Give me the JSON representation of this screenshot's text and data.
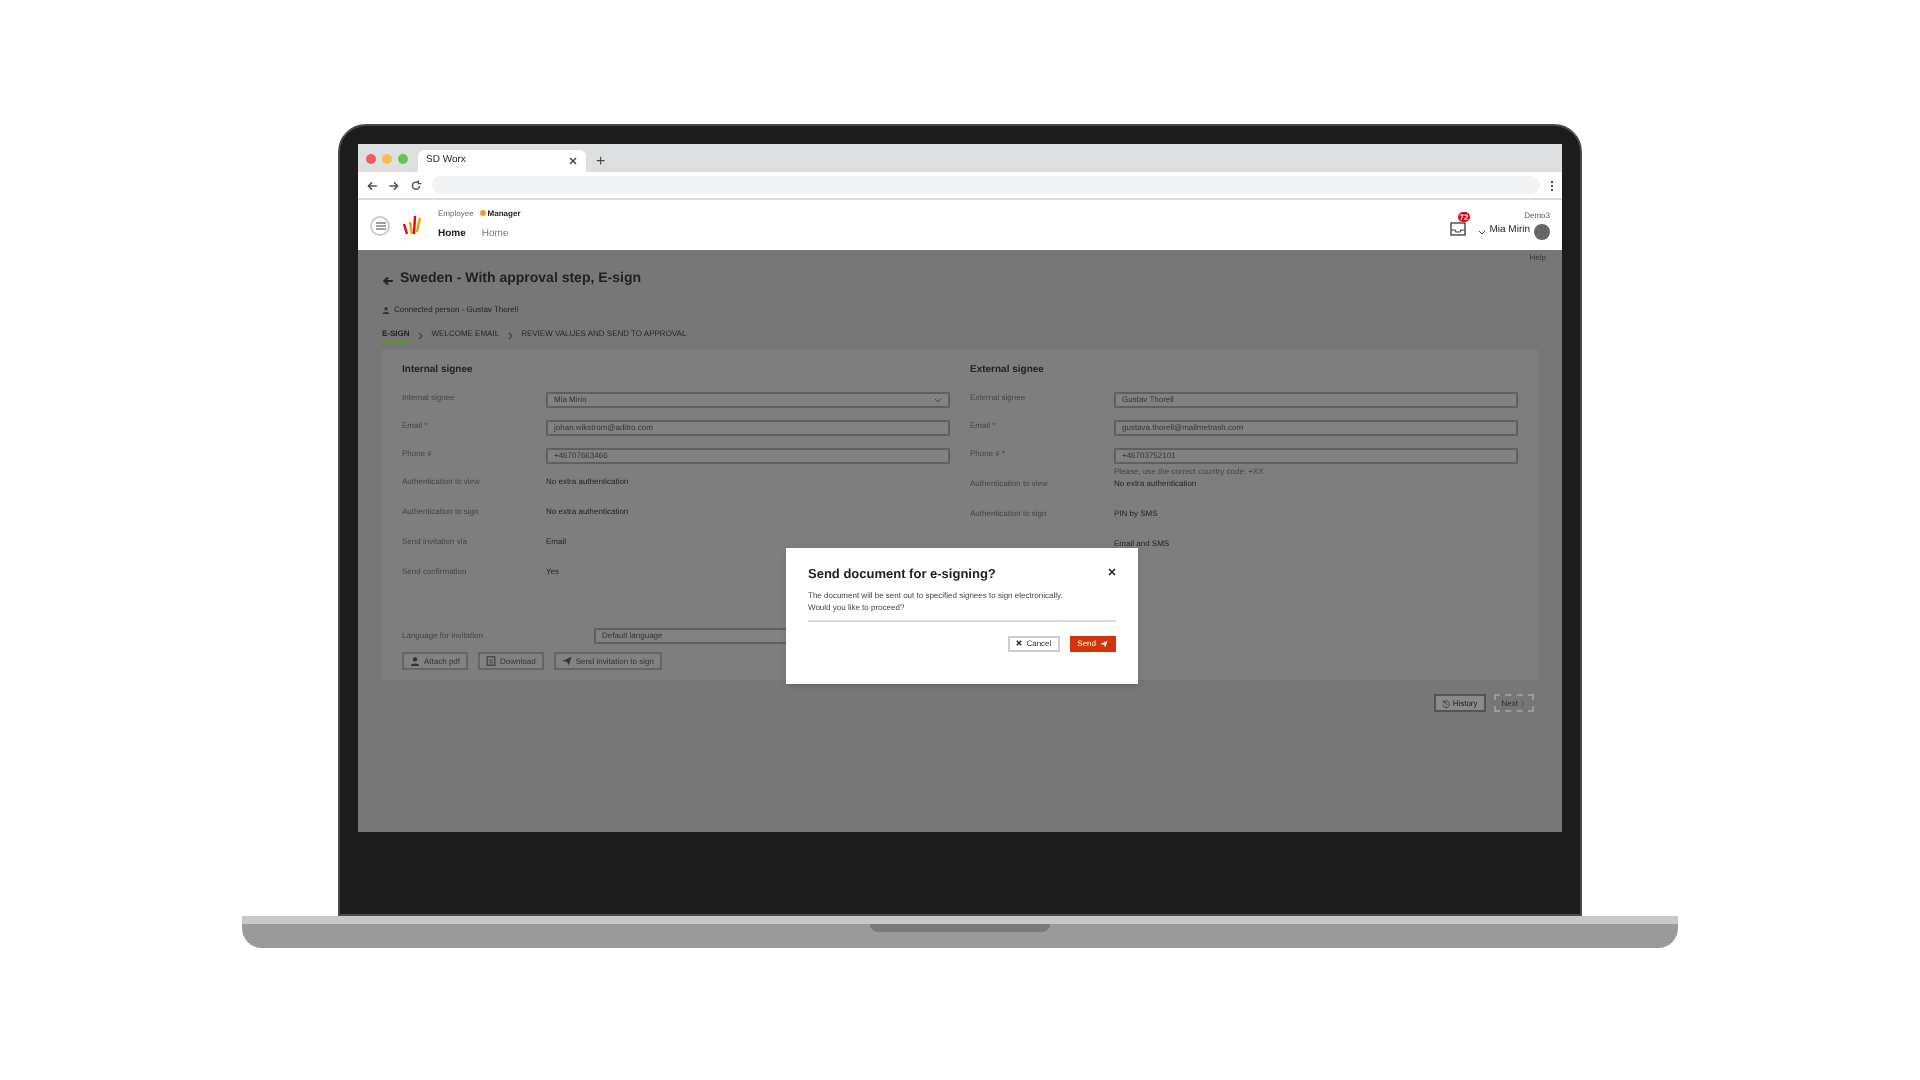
{
  "browser": {
    "tab_title": "SD Worx",
    "new_tab": "+"
  },
  "header": {
    "roles": [
      {
        "label": "Employee",
        "selected": false
      },
      {
        "label": "Manager",
        "selected": true
      }
    ],
    "nav": [
      {
        "label": "Home",
        "selected": true
      },
      {
        "label": "Home",
        "selected": false
      }
    ],
    "company": "Demo3",
    "user": "Mia Mirin",
    "notification_count": "72",
    "help": "Help"
  },
  "page": {
    "title": "Sweden - With approval step, E-sign",
    "connected_person": "Connected person - Gustav Thorell",
    "steps": [
      {
        "label": "E-SIGN",
        "selected": true
      },
      {
        "label": "WELCOME EMAIL",
        "selected": false
      },
      {
        "label": "REVIEW VALUES AND SEND TO APPROVAL",
        "selected": false
      }
    ]
  },
  "internal": {
    "heading": "Internal signee",
    "fields": [
      {
        "kind": "select",
        "label": "Internal signee",
        "value": "Mia Mirin"
      },
      {
        "kind": "input",
        "label": "Email *",
        "value": "johan.wikstrom@aditro.com"
      },
      {
        "kind": "input",
        "label": "Phone #",
        "value": "+46707663466"
      },
      {
        "kind": "text",
        "label": "Authentication to view",
        "value": "No extra authentication"
      },
      {
        "kind": "text",
        "label": "Authentication to sign",
        "value": "No extra authentication"
      },
      {
        "kind": "text",
        "label": "Send invitation via",
        "value": "Email"
      },
      {
        "kind": "text",
        "label": "Send confirmation",
        "value": "Yes"
      }
    ]
  },
  "external": {
    "heading": "External signee",
    "fields": [
      {
        "kind": "input",
        "label": "External signee",
        "value": "Gustav Thorell"
      },
      {
        "kind": "input",
        "label": "Email *",
        "value": "gustava.thorell@mailmetrash.com"
      },
      {
        "kind": "input",
        "label": "Phone # *",
        "value": "+46703752101",
        "hint": "Please, use the correct country code: +XX"
      },
      {
        "kind": "text",
        "label": "Authentication to view",
        "value": "No extra authentication"
      },
      {
        "kind": "text",
        "label": "Authentication to sign",
        "value": "PIN by SMS"
      },
      {
        "kind": "text",
        "value": "Email and SMS"
      }
    ]
  },
  "language": {
    "label": "Language for invitation",
    "value": "Default language"
  },
  "actions": [
    {
      "kind": "attach",
      "label": "Attach pdf"
    },
    {
      "kind": "download",
      "label": "Download"
    },
    {
      "kind": "send",
      "label": "Send invitation to sign"
    }
  ],
  "footer_buttons": [
    {
      "kind": "history",
      "label": "History",
      "disabled": false
    },
    {
      "kind": "next",
      "label": "Next",
      "disabled": true
    }
  ],
  "dialog": {
    "title": "Send document for e-signing?",
    "message": "The document will be sent out to specified signees to sign electronically.\nWould you like to proceed?",
    "cancel": "Cancel",
    "confirm": "Send"
  }
}
